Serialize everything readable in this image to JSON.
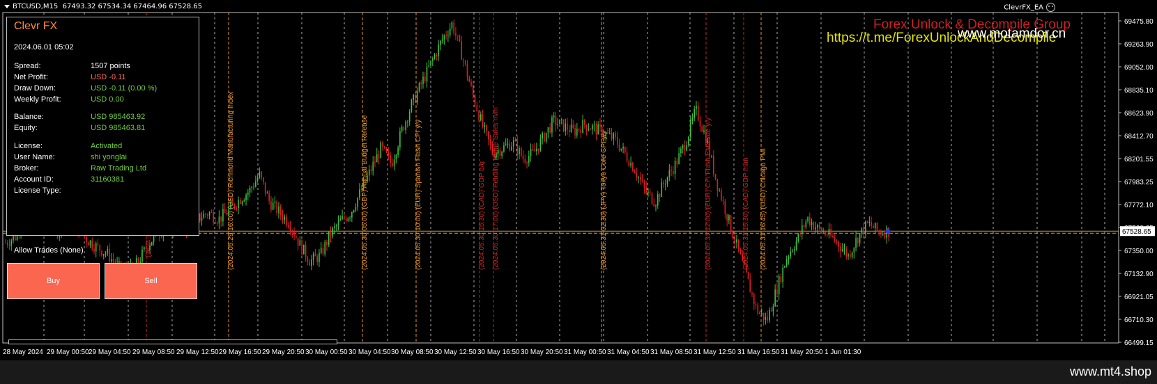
{
  "window": {
    "symbol": "BTCUSD,M15",
    "ohlc": "67493.32 67534.34 67464.96 67528.65",
    "ea_name": "ClevrFX_EA"
  },
  "watermarks": {
    "line1": "Forex Unlock & Decompile Group",
    "line2": "www.motamdor.cn",
    "line3": "https://t.me/ForexUnlockAndDecompile"
  },
  "panel": {
    "title": "Clevr FX",
    "datetime": "2024.06.01 05:02",
    "rows": [
      {
        "label": "Spread:",
        "value": "1507 points"
      },
      {
        "label": "Net Profit:",
        "value": "USD -0.11"
      },
      {
        "label": "Draw Down:",
        "value": "USD -0.11 (0.00 %)"
      },
      {
        "label": "Weekly Profit:",
        "value": "USD 0.00"
      },
      {
        "label": "Balance:",
        "value": "USD 985463.92"
      },
      {
        "label": "Equity:",
        "value": "USD 985463.81"
      },
      {
        "label": "License:",
        "value": "Activated"
      },
      {
        "label": "User Name:",
        "value": "shi yonglai"
      },
      {
        "label": "Broker:",
        "value": "Raw Trading Ltd"
      },
      {
        "label": "Account ID:",
        "value": "31160381"
      },
      {
        "label": "License Type:",
        "value": ""
      }
    ],
    "allow_trades": "Allow Trades (None)",
    "buy_label": "Buy",
    "sell_label": "Sell"
  },
  "footer": {
    "site": "www.mt4.shop"
  },
  "colors": {
    "bull": "#3fc43f",
    "bear": "#e01f1f",
    "price_line": "#c8a040",
    "grid": "#ffffff",
    "event_orange": "#e8952a",
    "event_red": "#c0271f",
    "button": "#fa6650"
  },
  "chart_data": {
    "type": "candlestick",
    "current_price": "67528.65",
    "y_ticks": [
      "69475.80",
      "69263.90",
      "69052.00",
      "68835.10",
      "68623.90",
      "68412.70",
      "68201.55",
      "67983.25",
      "67772.10",
      "67560.65",
      "67350.00",
      "67132.90",
      "66921.05",
      "66710.30",
      "66499.15"
    ],
    "ylim": [
      66499.15,
      69475.8
    ],
    "x_ticks": [
      "28 May 2024",
      "29 May 00:50",
      "29 May 04:50",
      "29 May 08:50",
      "29 May 12:50",
      "29 May 16:50",
      "29 May 20:50",
      "30 May 00:50",
      "30 May 04:50",
      "30 May 08:50",
      "30 May 12:50",
      "30 May 16:50",
      "30 May 20:50",
      "31 May 00:50",
      "31 May 04:50",
      "31 May 08:50",
      "31 May 12:50",
      "31 May 16:50",
      "31 May 20:50",
      "1 Jun 01:30"
    ],
    "events": [
      {
        "label": "(2024.05.29 06:00) ...",
        "color": "red"
      },
      {
        "label": "(2024.05.29 16:00) (USD) Richmond Manufacturing Index",
        "color": "orange"
      },
      {
        "label": "(2024.05.30 05:00) (GBP) Annual Budget Release",
        "color": "orange"
      },
      {
        "label": "(2024.05.30 10:00) (EUR) Spanish Flash CPI y/y",
        "color": "orange"
      },
      {
        "label": "(2024.05.30 15:30) (CAD) GDP q/q",
        "color": "red"
      },
      {
        "label": "(2024.05.30 17:00) (USD) Pending Home Sales m/m",
        "color": "red"
      },
      {
        "label": "(2024.05.31 02:30) (JPY) Tokyo Core CPI y/y",
        "color": "orange"
      },
      {
        "label": "(2024.05.31 12:00) (EUR) CPI Flash Estimate y/y",
        "color": "red"
      },
      {
        "label": "(2024.05.31 15:30) (CAD) GDP m/m",
        "color": "red"
      },
      {
        "label": "(2024.05.31 16:45) (USD) Chicago PMI",
        "color": "orange"
      }
    ],
    "close_path": [
      67420,
      67480,
      67750,
      67600,
      67700,
      67520,
      67640,
      67580,
      67450,
      67380,
      67320,
      67200,
      67150,
      67230,
      67400,
      67520,
      67560,
      67600,
      67550,
      67650,
      67700,
      67640,
      67720,
      67820,
      67900,
      68050,
      67800,
      67700,
      67600,
      67400,
      67250,
      67300,
      67500,
      67620,
      67700,
      67900,
      68100,
      68300,
      68150,
      68450,
      68700,
      68900,
      69100,
      69300,
      69450,
      69150,
      68800,
      68500,
      68250,
      68300,
      68350,
      68200,
      68250,
      68400,
      68550,
      68500,
      68450,
      68520,
      68480,
      68430,
      68380,
      68250,
      68100,
      67900,
      67800,
      68000,
      68150,
      68350,
      68650,
      68400,
      68000,
      67700,
      67400,
      67100,
      66800,
      66700,
      67000,
      67300,
      67450,
      67650,
      67550,
      67500,
      67420,
      67300,
      67480,
      67600,
      67520,
      67530
    ]
  }
}
